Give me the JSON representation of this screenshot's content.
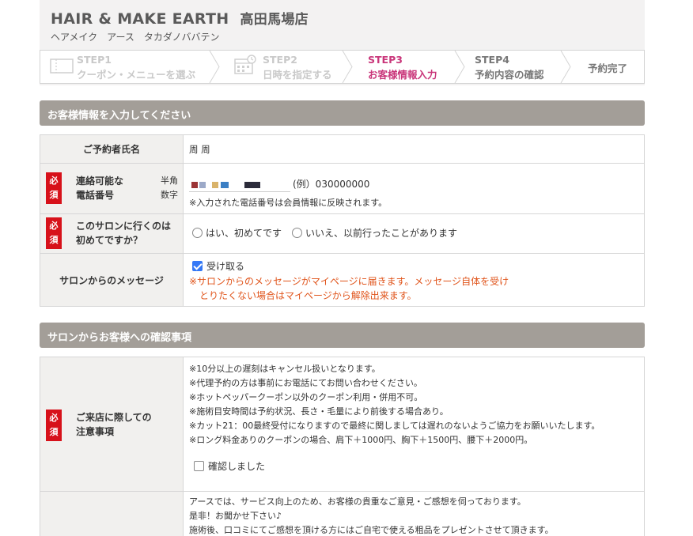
{
  "shop": {
    "name_en": "HAIR & MAKE EARTH",
    "name_jp": "高田馬場店",
    "kana": "ヘアメイク　アース　タカダノババテン"
  },
  "steps": [
    {
      "num": "STEP1",
      "label": "クーポン・メニューを選ぶ"
    },
    {
      "num": "STEP2",
      "label": "日時を指定する"
    },
    {
      "num": "STEP3",
      "label": "お客様情報入力"
    },
    {
      "num": "STEP4",
      "label": "予約内容の確認"
    },
    {
      "label": "予約完了"
    }
  ],
  "customer_section": {
    "title": "お客様情報を入力してください",
    "required": "必須",
    "name_label": "ご予約者氏名",
    "name_value": "周 周",
    "phone_label_1": "連絡可能な",
    "phone_label_2": "電話番号",
    "phone_hint_1": "半角",
    "phone_hint_2": "数字",
    "phone_example": "(例）030000000",
    "phone_note": "※入力された電話番号は会員情報に反映されます。",
    "first_label_1": "このサロンに行くのは",
    "first_label_2": "初めてですか？",
    "first_yes": "はい、初めてです",
    "first_no": "いいえ、以前行ったことがあります",
    "msg_label": "サロンからのメッセージ",
    "msg_receive": "受け取る",
    "msg_note_1": "※サロンからのメッセージがマイページに届きます。メッセージ自体を受け",
    "msg_note_2": "とりたくない場合はマイページから解除出来ます。"
  },
  "confirm_section": {
    "title": "サロンからお客様への確認事項",
    "required": "必須",
    "notice_label_1": "ご来店に際しての",
    "notice_label_2": "注意事項",
    "notes": [
      "※10分以上の遅刻はキャンセル扱いとなります。",
      "※代理予約の方は事前にお電話にてお問い合わせください。",
      "※ホットペッパークーポン以外のクーポン利用・併用不可。",
      "※施術目安時間は予約状況、長さ・毛量により前後する場合あり。",
      "※カット21：00最終受付になりますので最終に関しましては遅れのないようご協力をお願いいたします。",
      "※ロング料金ありのクーポンの場合、肩下＋1000円、胸下＋1500円、腰下＋2000円。"
    ],
    "confirm_check": "確認しました",
    "feedback": [
      "アースでは、サービス向上のため、お客様の貴重なご意見・ご感想を伺っております。",
      "是非！お聞かせ下さい♪",
      "施術後、口コミにてご感想を頂ける方にはご自宅で使える粗品をプレゼントさせて頂きます。"
    ]
  },
  "colors": {
    "accent": "#c9367a",
    "required": "#d7111a",
    "note": "#e0541b",
    "section_bar": "#a39e98"
  }
}
